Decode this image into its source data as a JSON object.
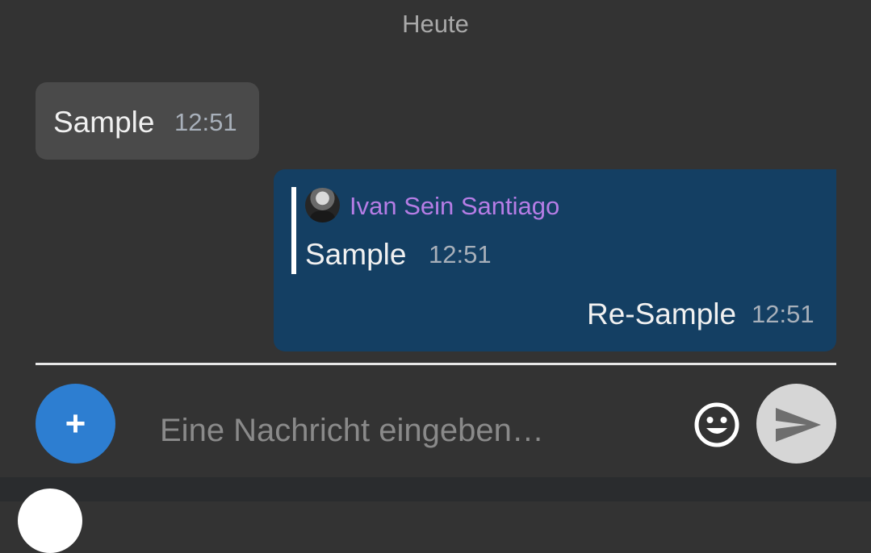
{
  "date_separator": "Heute",
  "messages": [
    {
      "direction": "incoming",
      "text": "Sample",
      "time": "12:51"
    },
    {
      "direction": "outgoing",
      "quote": {
        "author": "Ivan Sein Santiago",
        "text": "Sample",
        "time": "12:51"
      },
      "text": "Re-Sample",
      "time": "12:51"
    }
  ],
  "composer": {
    "placeholder": "Eine Nachricht eingeben…",
    "add_label": "+",
    "emoji_icon": "emoji-icon",
    "send_icon": "send-icon"
  },
  "colors": {
    "background": "#333333",
    "incoming_bubble": "#4a4a4a",
    "outgoing_bubble": "#143f63",
    "accent": "#2d7ed1",
    "quote_author": "#b67de6"
  }
}
